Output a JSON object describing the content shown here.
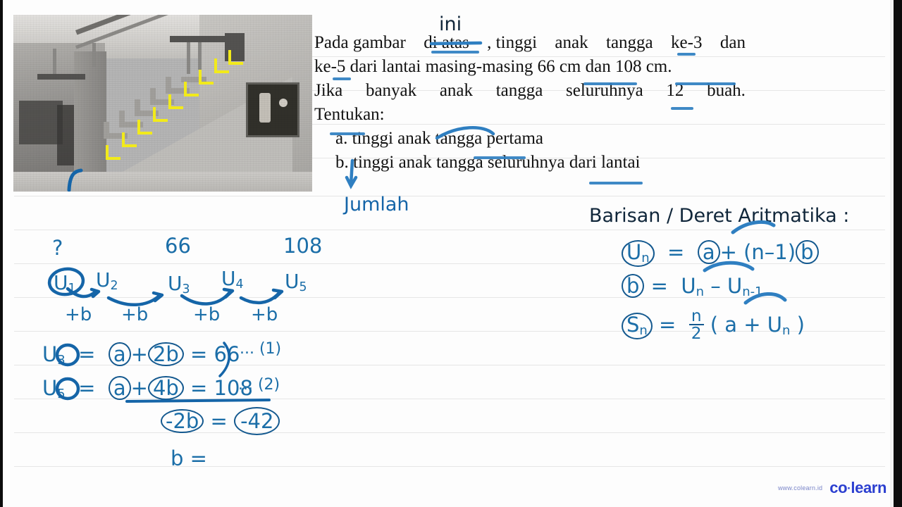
{
  "problem": {
    "lines": [
      "Pada gambar di atas, tinggi anak tangga ke-3 dan",
      "ke-5 dari lantai masing-masing 66 cm dan 108 cm.",
      "Jika banyak anak tangga seluruhnya 12 buah.",
      "Tentukan:"
    ],
    "line1_a": "Pada gambar",
    "line1_strike": "di atas",
    "line1_b": ", tinggi anak tangga ke-3 dan",
    "line2": "ke-5 dari lantai masing-masing 66 cm dan 108 cm.",
    "line3": "Jika banyak anak tangga seluruhnya 12 buah.",
    "line4": "Tentukan:",
    "item_a": "a.  tinggi anak tangga pertama",
    "item_b": "b.  tinggi anak tangga seluruhnya dari lantai"
  },
  "annotations": {
    "ini": "ini",
    "jumlah": "Jumlah"
  },
  "sequence": {
    "unknown_mark": "?",
    "value_u3": "66",
    "value_u5": "108",
    "terms": [
      "U1",
      "U2",
      "U3",
      "U4",
      "U5"
    ],
    "term_bases": [
      "U",
      "U",
      "U",
      "U",
      "U"
    ],
    "term_subs": [
      "1",
      "2",
      "3",
      "4",
      "5"
    ],
    "steps": [
      "+b",
      "+b",
      "+b",
      "+b"
    ]
  },
  "formulas": {
    "heading": "Barisan / Deret  Aritmatika :",
    "un_lhs": "Un",
    "un_rhs_a": "a",
    "un_rhs_rest": "+ (n-1) b",
    "b_lhs": "b",
    "b_rhs": "Un - Un-1",
    "sn_lhs": "Sn",
    "sn_frac_n": "n",
    "sn_frac_d": "2",
    "sn_rhs": "( a + Un )"
  },
  "work": {
    "eq1_lhs": "U3",
    "eq1_a": "a",
    "eq1_plus": "+",
    "eq1_b": "2b",
    "eq1_eq": "= 66",
    "eq1_tag": "... (1)",
    "eq2_lhs": "U5",
    "eq2_a": "a",
    "eq2_plus": "+",
    "eq2_b": "4b",
    "eq2_eq": "= 108",
    "eq2_tag": "... (2)",
    "result_lhs": "-2b",
    "result_eq": "=",
    "result_rhs": "-42",
    "final": "b ="
  },
  "logo": {
    "url": "www.colearn.id",
    "brand_left": "co",
    "brand_dot": "·",
    "brand_right": "learn"
  },
  "colors": {
    "ink_blue": "#14598f",
    "marker_blue": "#2f7fc1",
    "highlight_yellow": "#f2ea1a",
    "brand_blue": "#2b3fd0",
    "rule_gray": "#e6e6e6"
  }
}
